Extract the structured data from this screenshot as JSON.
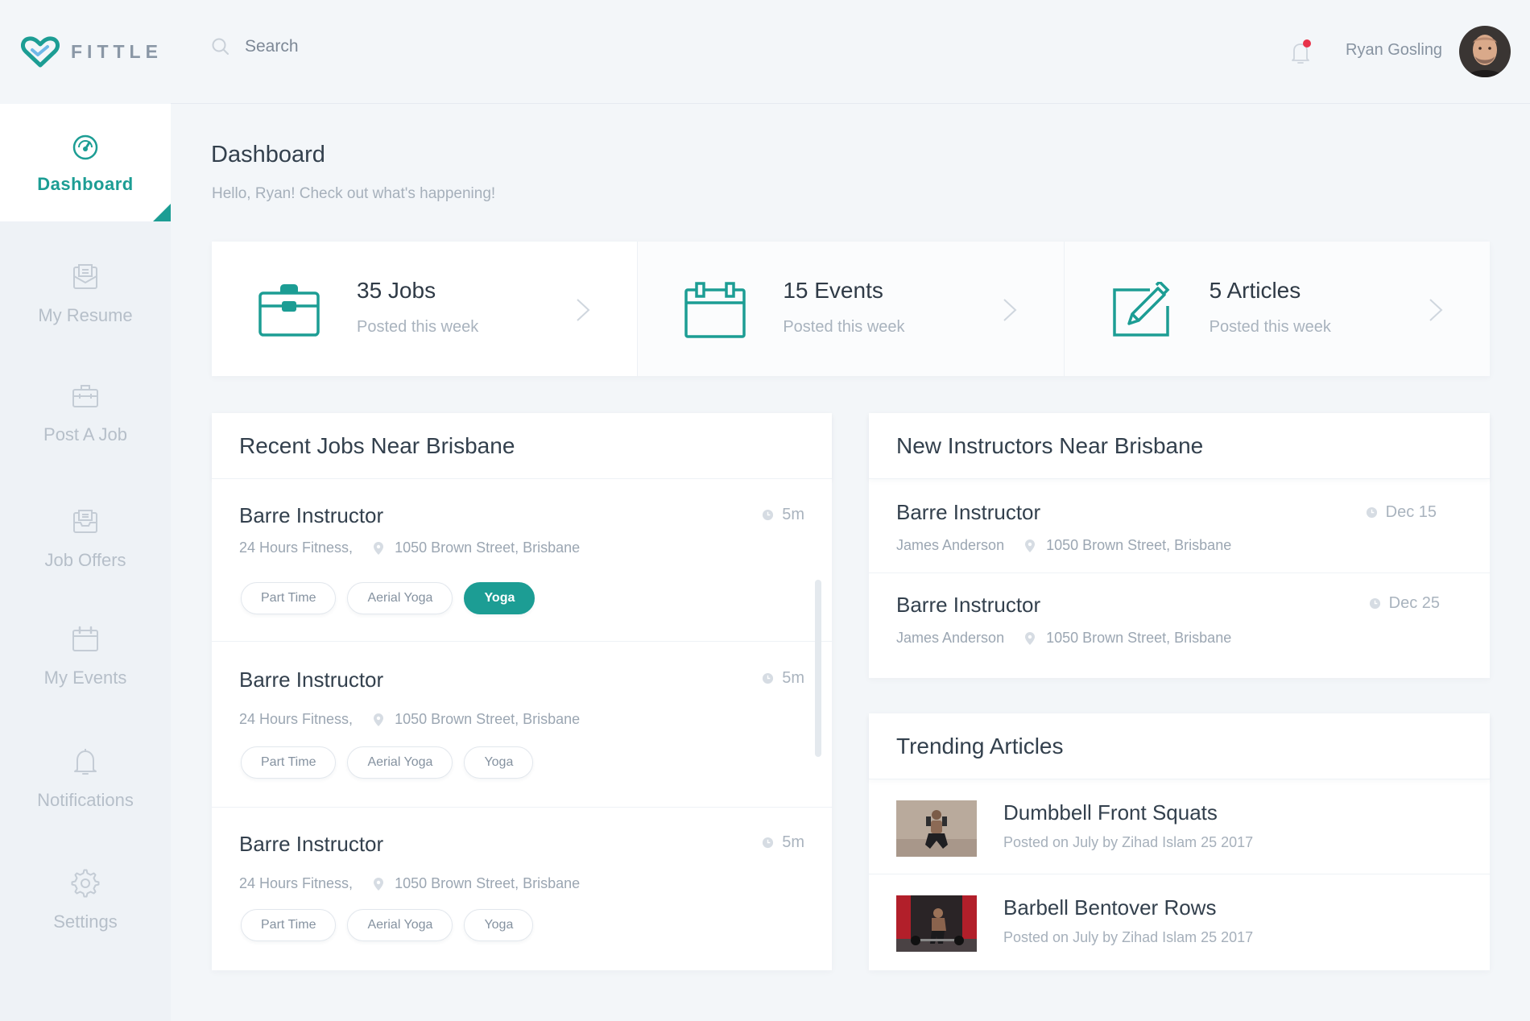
{
  "app": {
    "name": "FITTLE"
  },
  "colors": {
    "accent": "#1c9d94",
    "notification_dot": "#e8334a"
  },
  "sidebar": {
    "items": [
      {
        "label": "Dashboard",
        "icon": "gauge-icon",
        "active": true
      },
      {
        "label": "My Resume",
        "icon": "resume-icon",
        "active": false
      },
      {
        "label": "Post A Job",
        "icon": "briefcase-icon",
        "active": false
      },
      {
        "label": "Job Offers",
        "icon": "inbox-icon",
        "active": false
      },
      {
        "label": "My Events",
        "icon": "calendar-icon",
        "active": false
      },
      {
        "label": "Notifications",
        "icon": "bell-icon",
        "active": false
      },
      {
        "label": "Settings",
        "icon": "gear-icon",
        "active": false
      }
    ]
  },
  "header": {
    "search_placeholder": "Search",
    "user_name": "Ryan Gosling",
    "has_notification": true
  },
  "page": {
    "title": "Dashboard",
    "subtitle": "Hello, Ryan! Check out what's happening!"
  },
  "stats": [
    {
      "title": "35 Jobs",
      "subtitle": "Posted this week",
      "icon": "briefcase-icon"
    },
    {
      "title": "15 Events",
      "subtitle": "Posted this week",
      "icon": "calendar-icon"
    },
    {
      "title": "5 Articles",
      "subtitle": "Posted this week",
      "icon": "edit-icon"
    }
  ],
  "recent_jobs": {
    "title": "Recent Jobs Near Brisbane",
    "items": [
      {
        "title": "Barre Instructor",
        "company": "24 Hours Fitness,",
        "address": "1050 Brown Street, Brisbane",
        "time": "5m",
        "tags": [
          {
            "label": "Part Time",
            "active": false
          },
          {
            "label": "Aerial Yoga",
            "active": false
          },
          {
            "label": "Yoga",
            "active": true
          }
        ]
      },
      {
        "title": "Barre Instructor",
        "company": "24 Hours Fitness,",
        "address": "1050 Brown Street, Brisbane",
        "time": "5m",
        "tags": [
          {
            "label": "Part Time",
            "active": false
          },
          {
            "label": "Aerial Yoga",
            "active": false
          },
          {
            "label": "Yoga",
            "active": false
          }
        ]
      },
      {
        "title": "Barre Instructor",
        "company": "24 Hours Fitness,",
        "address": "1050 Brown Street, Brisbane",
        "time": "5m",
        "tags": [
          {
            "label": "Part Time",
            "active": false
          },
          {
            "label": "Aerial Yoga",
            "active": false
          },
          {
            "label": "Yoga",
            "active": false
          }
        ]
      }
    ]
  },
  "instructors": {
    "title": "New Instructors Near Brisbane",
    "items": [
      {
        "title": "Barre Instructor",
        "name": "James Anderson",
        "address": "1050 Brown Street, Brisbane",
        "date": "Dec 15"
      },
      {
        "title": "Barre Instructor",
        "name": "James Anderson",
        "address": "1050 Brown Street, Brisbane",
        "date": "Dec 25"
      }
    ]
  },
  "articles": {
    "title": "Trending Articles",
    "items": [
      {
        "title": "Dumbbell Front Squats",
        "meta": "Posted on July by Zihad Islam 25 2017"
      },
      {
        "title": "Barbell Bentover Rows",
        "meta": "Posted on July by Zihad Islam 25 2017"
      }
    ]
  }
}
